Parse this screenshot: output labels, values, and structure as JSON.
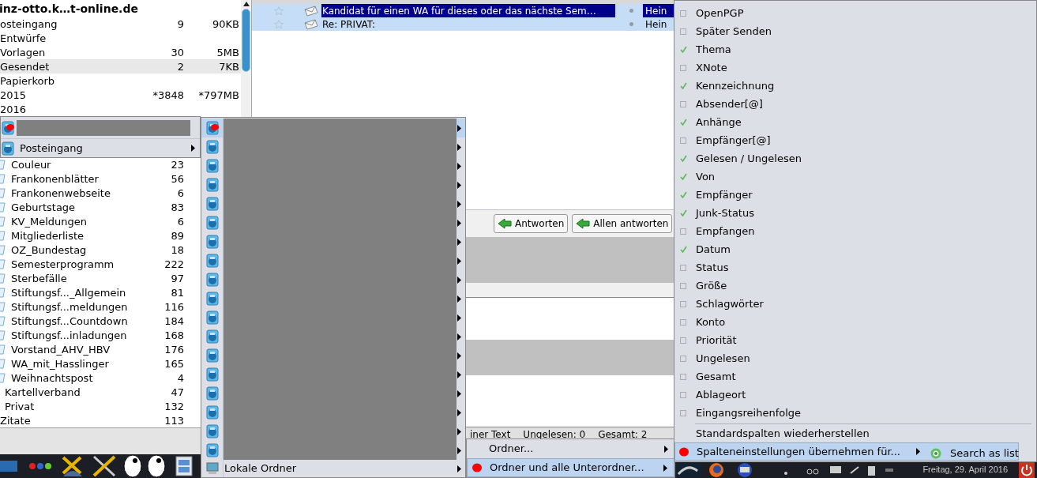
{
  "folder_pane": {
    "account": "inz-otto.k…t-online.de",
    "folders": [
      {
        "name": "osteingang",
        "count": "9",
        "size": "90KB",
        "selected": false
      },
      {
        "name": "Entwürfe",
        "selected": false
      },
      {
        "name": "Vorlagen",
        "count": "30",
        "size": "5MB",
        "selected": false
      },
      {
        "name": "Gesendet",
        "count": "2",
        "size": "7KB",
        "selected": true
      },
      {
        "name": "Papierkorb",
        "selected": false
      },
      {
        "name": "2015",
        "count": "*3848",
        "size": "*797MB",
        "selected": false
      },
      {
        "name": "2016",
        "selected": false
      }
    ],
    "subfolders": [
      {
        "kind": "folder",
        "name": "Couleur",
        "count": "23"
      },
      {
        "kind": "folder",
        "name": "Frankonenblätter",
        "count": "56"
      },
      {
        "kind": "folder",
        "name": "Frankonenwebseite",
        "count": "6"
      },
      {
        "kind": "folder",
        "name": "Geburtstage",
        "count": "83"
      },
      {
        "kind": "folder",
        "name": "KV_Meldungen",
        "count": "6"
      },
      {
        "kind": "folder",
        "name": "Mitgliederliste",
        "count": "89"
      },
      {
        "kind": "folder",
        "name": "OZ_Bundestag",
        "count": "18"
      },
      {
        "kind": "folder",
        "name": "Semesterprogramm",
        "count": "222"
      },
      {
        "kind": "folder",
        "name": "Sterbefälle",
        "count": "97"
      },
      {
        "kind": "folder",
        "name": "Stiftungsf..._Allgemein",
        "count": "81"
      },
      {
        "kind": "folder",
        "name": "Stiftungsf...meldungen",
        "count": "116"
      },
      {
        "kind": "folder",
        "name": "Stiftungsf...Countdown",
        "count": "184"
      },
      {
        "kind": "folder",
        "name": "Stiftungsf...inladungen",
        "count": "168"
      },
      {
        "kind": "folder",
        "name": "Vorstand_AHV_HBV",
        "count": "176"
      },
      {
        "kind": "folder",
        "name": "WA_mit_Hasslinger",
        "count": "165"
      },
      {
        "kind": "folder",
        "name": "Weihnachtspost",
        "count": "4"
      },
      {
        "kind": "plain",
        "name": "Kartellverband",
        "count": "47"
      },
      {
        "kind": "plain",
        "name": "Privat",
        "count": "132"
      },
      {
        "kind": "root",
        "name": "Zitate",
        "count": "113"
      }
    ]
  },
  "message_list": {
    "rows": [
      {
        "subject": "Kandidat für einen WA für dieses oder das nächste Sem…",
        "sender": "Hein",
        "selected": true,
        "current": true
      },
      {
        "subject": "Re: PRIVAT:",
        "sender": "Hein",
        "selected": true,
        "current": false
      }
    ]
  },
  "toolbar": {
    "buttons": [
      "Antworten",
      "Allen antworten"
    ]
  },
  "status_bar": {
    "items": [
      "iner Text",
      "Ungelesen: 0",
      "Gesamt: 2"
    ]
  },
  "account_menu": {
    "items": [
      {
        "kind": "redacted",
        "selected": false
      },
      {
        "kind": "submenu",
        "label": "Posteingang",
        "selected": false
      }
    ]
  },
  "folder_menu": {
    "items": [
      {
        "kind": "redacted",
        "selected": true
      },
      {
        "kind": "redacted",
        "selected": false
      },
      {
        "kind": "redacted",
        "selected": false
      },
      {
        "kind": "redacted",
        "selected": false
      },
      {
        "kind": "redacted",
        "selected": false
      },
      {
        "kind": "redacted",
        "selected": false
      },
      {
        "kind": "redacted",
        "selected": false
      },
      {
        "kind": "redacted",
        "selected": false
      },
      {
        "kind": "redacted",
        "selected": false
      },
      {
        "kind": "redacted",
        "selected": false
      },
      {
        "kind": "redacted",
        "selected": false
      },
      {
        "kind": "redacted",
        "selected": false
      },
      {
        "kind": "redacted",
        "selected": false
      },
      {
        "kind": "redacted",
        "selected": false
      },
      {
        "kind": "redacted",
        "selected": false
      },
      {
        "kind": "redacted",
        "selected": false
      },
      {
        "kind": "redacted",
        "selected": false
      },
      {
        "kind": "redacted",
        "selected": false
      },
      {
        "kind": "local",
        "label": "Lokale Ordner",
        "selected": false
      }
    ]
  },
  "scope_menu": {
    "items": [
      {
        "label": "Ordner...",
        "selected": false
      },
      {
        "label": "Ordner und alle Unterordner...",
        "selected": true
      }
    ]
  },
  "column_menu": {
    "columns": [
      {
        "label": "OpenPGP",
        "checked": false
      },
      {
        "label": "Später Senden",
        "checked": false
      },
      {
        "label": "Thema",
        "checked": true
      },
      {
        "label": "XNote",
        "checked": false
      },
      {
        "label": "Kennzeichnung",
        "checked": true
      },
      {
        "label": "Absender[@]",
        "checked": false
      },
      {
        "label": "Anhänge",
        "checked": true
      },
      {
        "label": "Empfänger[@]",
        "checked": false
      },
      {
        "label": "Gelesen / Ungelesen",
        "checked": true
      },
      {
        "label": "Von",
        "checked": true
      },
      {
        "label": "Empfänger",
        "checked": true
      },
      {
        "label": "Junk-Status",
        "checked": true
      },
      {
        "label": "Empfangen",
        "checked": false
      },
      {
        "label": "Datum",
        "checked": true
      },
      {
        "label": "Status",
        "checked": false
      },
      {
        "label": "Größe",
        "checked": false
      },
      {
        "label": "Schlagwörter",
        "checked": false
      },
      {
        "label": "Konto",
        "checked": false
      },
      {
        "label": "Priorität",
        "checked": false
      },
      {
        "label": "Ungelesen",
        "checked": false
      },
      {
        "label": "Gesamt",
        "checked": false
      },
      {
        "label": "Ablageort",
        "checked": false
      },
      {
        "label": "Eingangsreihenfolge",
        "checked": false
      }
    ],
    "actions": [
      {
        "kind": "plain",
        "label": "Standardspalten wiederherstellen",
        "selected": false
      },
      {
        "kind": "submenu",
        "label": "Spalteneinstellungen übernehmen für...",
        "selected": true
      }
    ],
    "submenu": {
      "items": [
        "Search as list"
      ]
    }
  },
  "taskbar": {
    "date": "Freitag, 29. April 2016"
  }
}
